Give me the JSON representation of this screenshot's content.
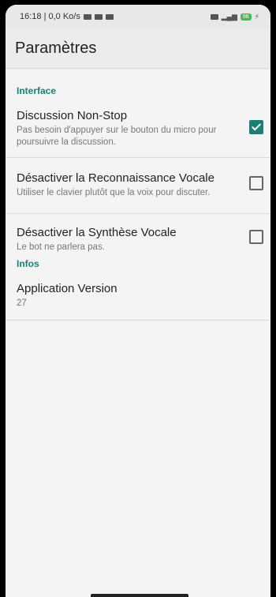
{
  "status_bar": {
    "left_text": "16:18 | 0,0 Ko/s",
    "battery": "98"
  },
  "app_bar": {
    "title": "Paramètres"
  },
  "sections": [
    {
      "header": "Interface",
      "items": [
        {
          "title": "Discussion Non-Stop",
          "summary": "Pas besoin d'appuyer sur le bouton du micro pour poursuivre la discussion.",
          "checked": true
        },
        {
          "title": "Désactiver la Reconnaissance Vocale",
          "summary": "Utiliser le clavier plutôt que la voix pour discuter.",
          "checked": false
        },
        {
          "title": "Désactiver la Synthèse Vocale",
          "summary": "Le bot ne parlera pas.",
          "checked": false
        }
      ]
    },
    {
      "header": "Infos",
      "items": [
        {
          "title": "Application Version",
          "summary": "27"
        }
      ]
    }
  ],
  "colors": {
    "accent": "#1c7f74",
    "background": "#f4f4f4"
  }
}
